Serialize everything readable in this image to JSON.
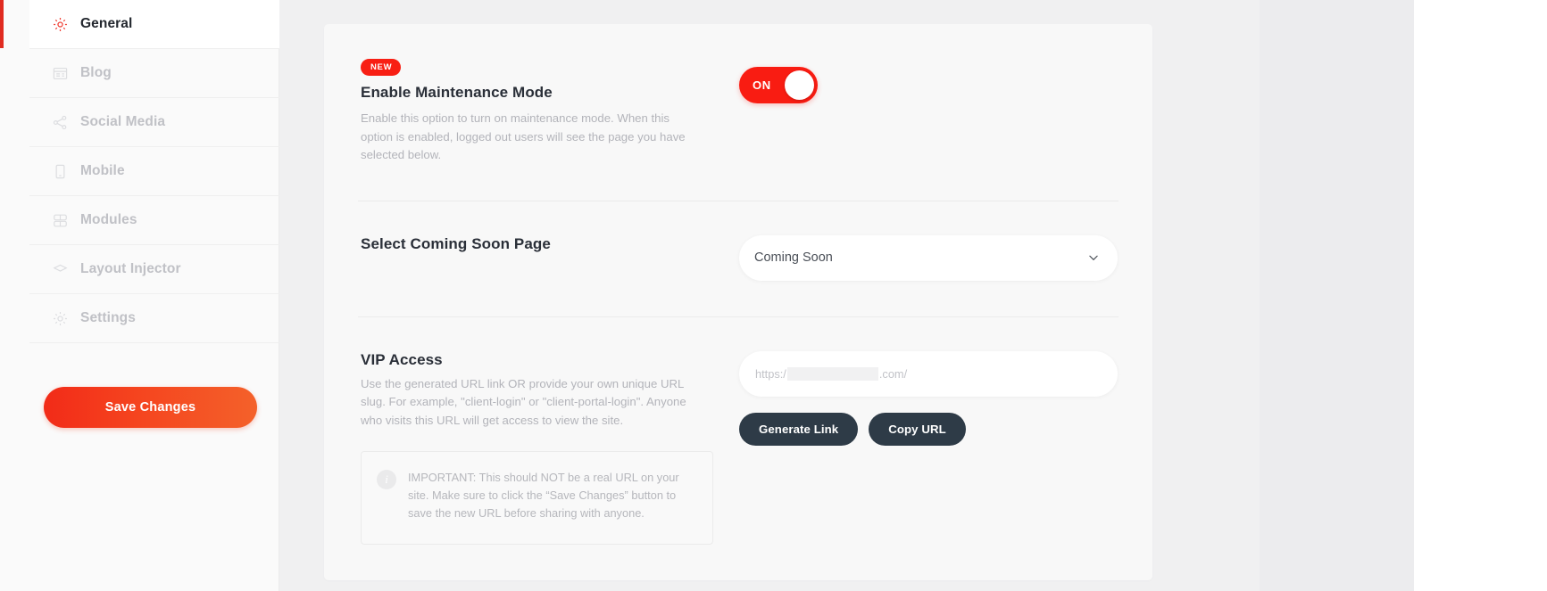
{
  "sidebar": {
    "items": [
      {
        "label": "General",
        "icon": "gear-icon",
        "active": true
      },
      {
        "label": "Blog",
        "icon": "blog-icon",
        "active": false
      },
      {
        "label": "Social Media",
        "icon": "share-icon",
        "active": false
      },
      {
        "label": "Mobile",
        "icon": "mobile-icon",
        "active": false
      },
      {
        "label": "Modules",
        "icon": "modules-icon",
        "active": false
      },
      {
        "label": "Layout Injector",
        "icon": "layers-icon",
        "active": false
      },
      {
        "label": "Settings",
        "icon": "gear-outline-icon",
        "active": false
      }
    ],
    "save_label": "Save Changes"
  },
  "maintenance": {
    "badge": "NEW",
    "title": "Enable Maintenance Mode",
    "description": "Enable this option to turn on maintenance mode. When this option is enabled, logged out users will see the page you have selected below.",
    "toggle_state": "ON"
  },
  "coming_soon": {
    "title": "Select Coming Soon Page",
    "selected": "Coming Soon",
    "options": [
      "Coming Soon"
    ]
  },
  "vip": {
    "title": "VIP Access",
    "description": "Use the generated URL link OR provide your own unique URL slug. For example, \"client-login\" or \"client-portal-login\". Anyone who visits this URL will get access to view the site.",
    "url_prefix": "https:/",
    "url_suffix": ".com/",
    "generate_label": "Generate Link",
    "copy_label": "Copy URL",
    "notice_icon": "info-icon",
    "notice": "IMPORTANT: This should NOT be a real URL on your site. Make sure to click the “Save Changes” button to save the new URL before sharing with anyone."
  },
  "colors": {
    "accent_red": "#f81f14",
    "accent_gradient_end": "#f4612a",
    "dark_button": "#2e3b47",
    "muted_text": "#b3b4ba",
    "heading_text": "#2a2f38"
  }
}
